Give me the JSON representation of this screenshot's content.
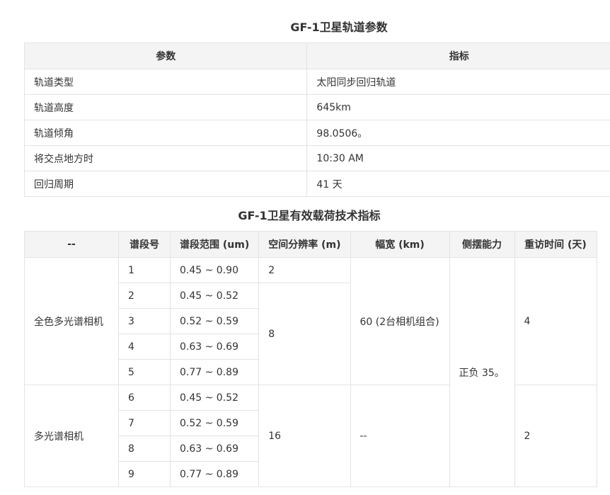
{
  "orbit": {
    "title": "GF-1卫星轨道参数",
    "headers": [
      "参数",
      "指标"
    ],
    "rows": [
      [
        "轨道类型",
        "太阳同步回归轨道"
      ],
      [
        "轨道高度",
        "645km"
      ],
      [
        "轨道倾角",
        "98.0506。"
      ],
      [
        "将交点地方时",
        "10:30 AM"
      ],
      [
        "回归周期",
        "41 天"
      ]
    ]
  },
  "payload": {
    "title": "GF-1卫星有效载荷技术指标",
    "headers": [
      "--",
      "谱段号",
      "谱段范围 (um)",
      "空间分辨率 (m)",
      "幅宽 (km)",
      "侧摆能力",
      "重访时间 (天)"
    ],
    "pan_camera": "全色多光谱相机",
    "ms_camera": "多光谱相机",
    "bands": [
      {
        "no": "1",
        "range": "0.45 ~ 0.90"
      },
      {
        "no": "2",
        "range": "0.45 ~ 0.52"
      },
      {
        "no": "3",
        "range": "0.52 ~ 0.59"
      },
      {
        "no": "4",
        "range": "0.63 ~ 0.69"
      },
      {
        "no": "5",
        "range": "0.77 ~ 0.89"
      },
      {
        "no": "6",
        "range": "0.45 ~ 0.52"
      },
      {
        "no": "7",
        "range": "0.52 ~ 0.59"
      },
      {
        "no": "8",
        "range": "0.63 ~ 0.69"
      },
      {
        "no": "9",
        "range": "0.77 ~ 0.89"
      }
    ],
    "res_pan": "2",
    "res_pan_ms": "8",
    "res_ms": "16",
    "swath_pan": "60 (2台相机组合)",
    "swath_ms": "--",
    "side_swing": "正负 35。",
    "revisit_pan": "4",
    "revisit_ms": "2"
  }
}
